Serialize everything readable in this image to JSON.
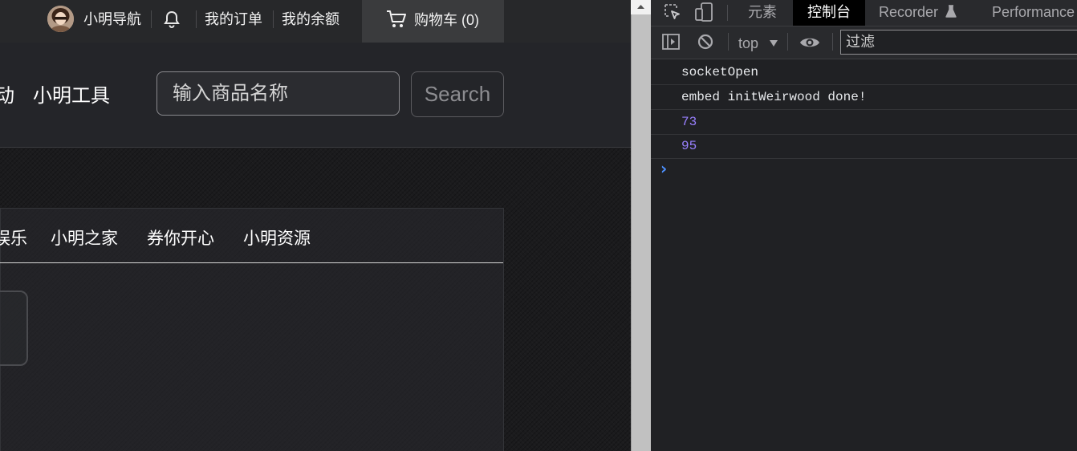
{
  "site": {
    "top_links": {
      "nav": "小明导航",
      "orders": "我的订单",
      "balance": "我的余额"
    },
    "cart_label": "购物车 (0)",
    "nav": {
      "partial_left": "动",
      "tools": "小明工具"
    },
    "search": {
      "placeholder": "输入商品名称",
      "button": "Search"
    },
    "tabs": [
      "娱乐",
      "小明之家",
      "券你开心",
      "小明资源"
    ]
  },
  "devtools": {
    "tabs": {
      "elements": "元素",
      "console": "控制台",
      "recorder": "Recorder",
      "performance": "Performance"
    },
    "context": "top",
    "filter_placeholder": "过滤",
    "logs": [
      {
        "text": "socketOpen",
        "color": "#e8eaed"
      },
      {
        "text": "embed initWeirwood done!",
        "color": "#e8eaed"
      },
      {
        "text": "73",
        "color": "#9980ff"
      },
      {
        "text": "95",
        "color": "#9980ff"
      }
    ],
    "prompt": "›"
  },
  "icons": [
    "avatar",
    "bell-icon",
    "cart-icon",
    "inspect-icon",
    "device-icon",
    "flask-icon",
    "sidebar-icon",
    "clear-icon",
    "dropdown-icon",
    "eye-icon"
  ],
  "colors": {
    "accent_blue": "#4d90fe",
    "log_number": "#9980ff"
  }
}
